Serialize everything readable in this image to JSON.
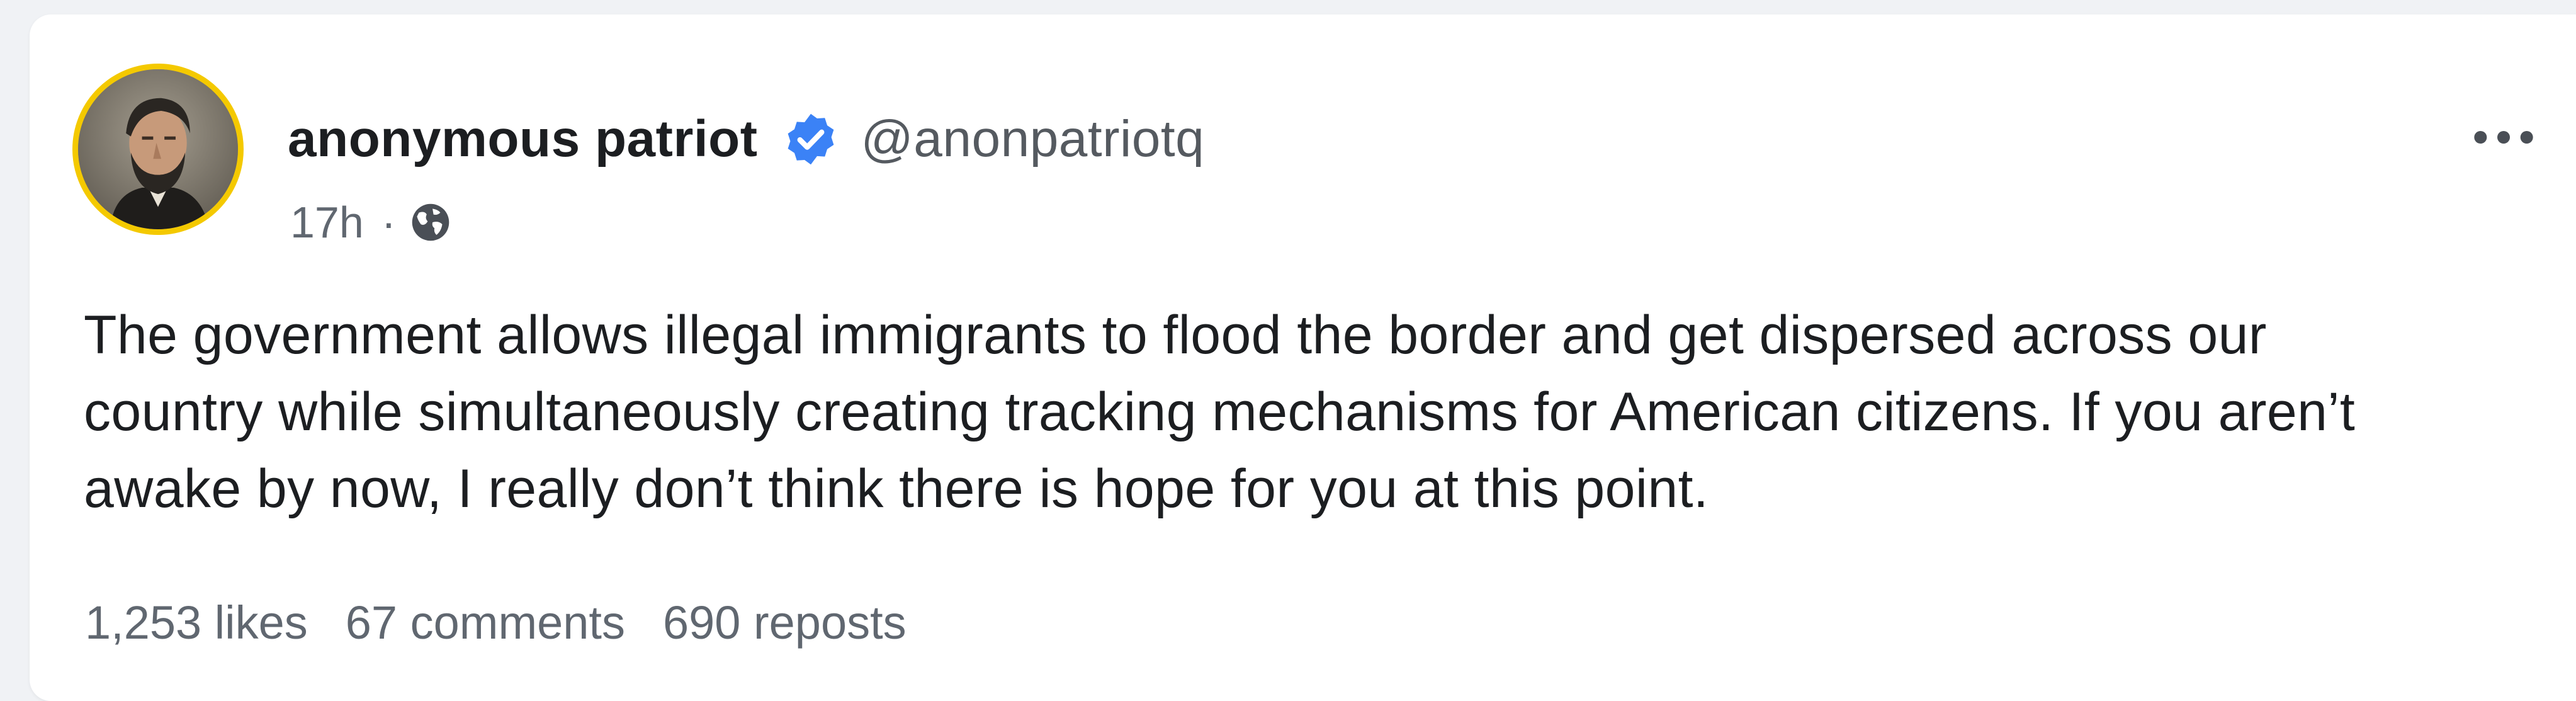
{
  "post": {
    "author": {
      "name": "anonymous patriot",
      "handle": "@anonpatriotq",
      "verified": true,
      "avatar_icon": "portrait-avatar",
      "avatar_ring_color": "#f4c900"
    },
    "meta": {
      "time": "17h",
      "separator": "·",
      "audience_icon": "globe-icon"
    },
    "more_icon": "more-horizontal-icon",
    "text_lines": [
      "The government allows illegal immigrants to flood the border and get dispersed across our",
      "country while simultaneously creating tracking mechanisms for American citizens. If you aren’t",
      "awake by now, I really don’t think there is hope for you at this point."
    ],
    "stats": {
      "likes": "1,253 likes",
      "comments": "67 comments",
      "reposts": "690 reposts"
    }
  },
  "colors": {
    "verified_badge": "#3b82f6",
    "page_background": "#f0f2f5",
    "card_background": "#ffffff"
  }
}
